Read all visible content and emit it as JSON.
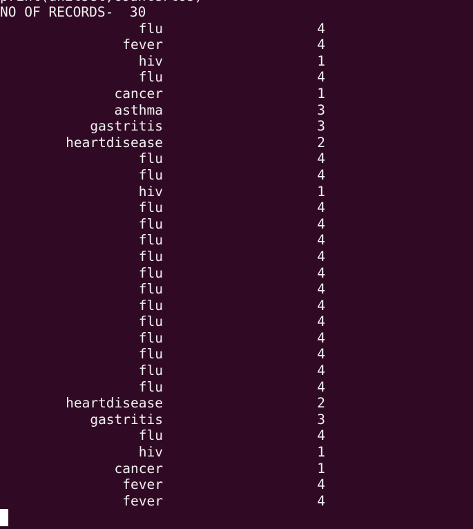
{
  "terminal": {
    "background": "#300a24",
    "foreground": "#f2f2f2",
    "previous_line_partial": "print(unitset,countertos)",
    "header_label": "NO OF RECORDS-",
    "record_count": "30",
    "records": [
      {
        "name": "flu",
        "count": "4"
      },
      {
        "name": "fever",
        "count": "4"
      },
      {
        "name": "hiv",
        "count": "1"
      },
      {
        "name": "flu",
        "count": "4"
      },
      {
        "name": "cancer",
        "count": "1"
      },
      {
        "name": "asthma",
        "count": "3"
      },
      {
        "name": "gastritis",
        "count": "3"
      },
      {
        "name": "heartdisease",
        "count": "2"
      },
      {
        "name": "flu",
        "count": "4"
      },
      {
        "name": "flu",
        "count": "4"
      },
      {
        "name": "hiv",
        "count": "1"
      },
      {
        "name": "flu",
        "count": "4"
      },
      {
        "name": "flu",
        "count": "4"
      },
      {
        "name": "flu",
        "count": "4"
      },
      {
        "name": "flu",
        "count": "4"
      },
      {
        "name": "flu",
        "count": "4"
      },
      {
        "name": "flu",
        "count": "4"
      },
      {
        "name": "flu",
        "count": "4"
      },
      {
        "name": "flu",
        "count": "4"
      },
      {
        "name": "flu",
        "count": "4"
      },
      {
        "name": "flu",
        "count": "4"
      },
      {
        "name": "flu",
        "count": "4"
      },
      {
        "name": "flu",
        "count": "4"
      },
      {
        "name": "heartdisease",
        "count": "2"
      },
      {
        "name": "gastritis",
        "count": "3"
      },
      {
        "name": "flu",
        "count": "4"
      },
      {
        "name": "hiv",
        "count": "1"
      },
      {
        "name": "cancer",
        "count": "1"
      },
      {
        "name": "fever",
        "count": "4"
      },
      {
        "name": "fever",
        "count": "4"
      }
    ]
  }
}
